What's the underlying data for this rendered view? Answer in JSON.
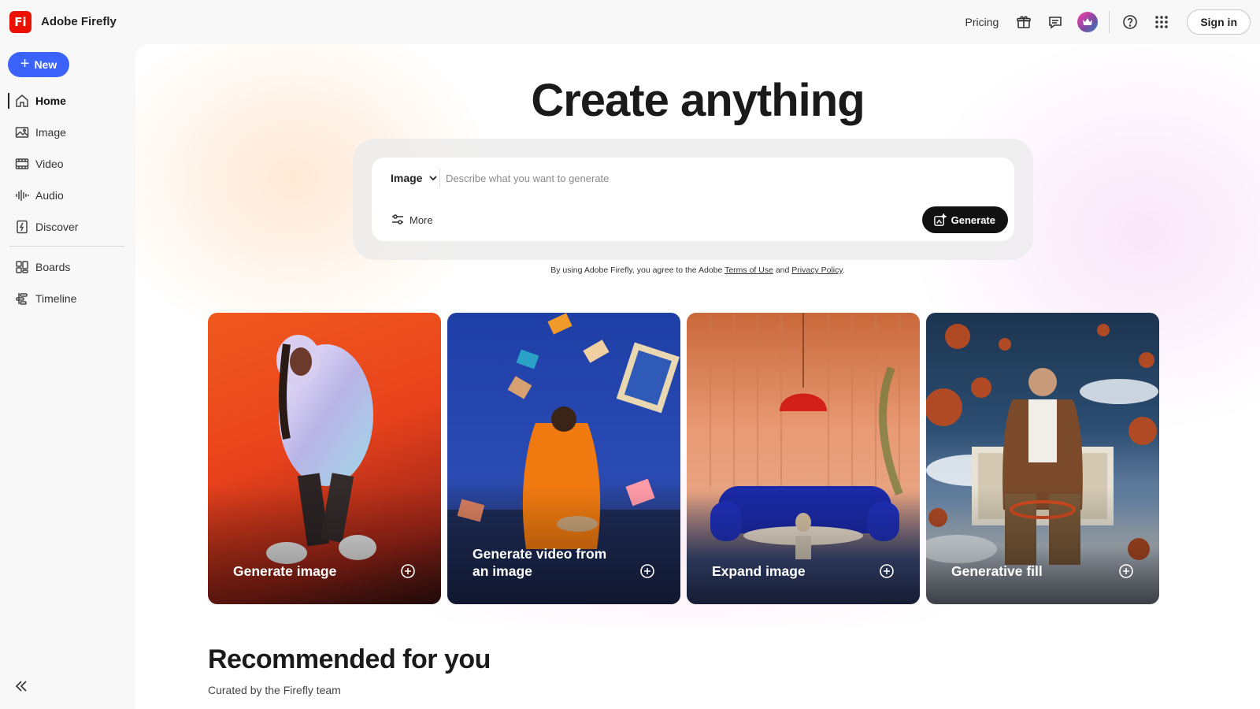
{
  "app": {
    "logo_text": "Fi",
    "title": "Adobe Firefly",
    "brand_color": "#eb1000",
    "accent_color": "#3b63fb"
  },
  "topbar": {
    "pricing": "Pricing",
    "icons": [
      "gift-icon",
      "chat-icon",
      "premium-crown-icon",
      "help-icon",
      "apps-grid-icon"
    ],
    "signin": "Sign in"
  },
  "sidebar": {
    "new_label": "New",
    "items": [
      {
        "label": "Home",
        "icon": "home-icon",
        "active": true
      },
      {
        "label": "Image",
        "icon": "image-icon"
      },
      {
        "label": "Video",
        "icon": "video-icon"
      },
      {
        "label": "Audio",
        "icon": "audio-icon"
      },
      {
        "label": "Discover",
        "icon": "discover-icon"
      },
      {
        "label": "Boards",
        "icon": "boards-icon"
      },
      {
        "label": "Timeline",
        "icon": "timeline-icon"
      }
    ],
    "collapse_icon": "double-chevron-left-icon"
  },
  "hero": {
    "title": "Create anything",
    "mode": "Image",
    "placeholder": "Describe what you want to generate",
    "more_label": "More",
    "generate_label": "Generate",
    "terms_prefix": "By using Adobe Firefly, you agree to the Adobe ",
    "terms_link": "Terms of Use",
    "terms_and": " and ",
    "privacy_link": "Privacy Policy",
    "terms_suffix": "."
  },
  "cards": [
    {
      "label": "Generate image"
    },
    {
      "label": "Generate video from an image"
    },
    {
      "label": "Expand image"
    },
    {
      "label": "Generative fill"
    }
  ],
  "recommended": {
    "title": "Recommended for you",
    "subtitle": "Curated by the Firefly team"
  }
}
